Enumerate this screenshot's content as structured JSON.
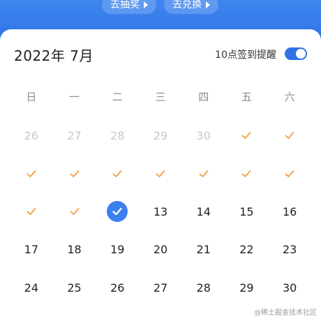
{
  "header": {
    "lottery_label": "去抽奖",
    "exchange_label": "去兑换"
  },
  "calendar": {
    "title": "2022年 7月",
    "reminder_label": "10点签到提醒",
    "reminder_on": true,
    "weekdays": [
      "日",
      "一",
      "二",
      "三",
      "四",
      "五",
      "六"
    ],
    "rows": [
      [
        {
          "label": "26",
          "state": "other-month"
        },
        {
          "label": "27",
          "state": "other-month"
        },
        {
          "label": "28",
          "state": "other-month"
        },
        {
          "label": "29",
          "state": "other-month"
        },
        {
          "label": "30",
          "state": "other-month"
        },
        {
          "label": "",
          "state": "signed"
        },
        {
          "label": "",
          "state": "signed"
        }
      ],
      [
        {
          "label": "",
          "state": "signed"
        },
        {
          "label": "",
          "state": "signed"
        },
        {
          "label": "",
          "state": "signed"
        },
        {
          "label": "",
          "state": "signed"
        },
        {
          "label": "",
          "state": "signed"
        },
        {
          "label": "",
          "state": "signed"
        },
        {
          "label": "",
          "state": "signed"
        }
      ],
      [
        {
          "label": "",
          "state": "signed"
        },
        {
          "label": "",
          "state": "signed"
        },
        {
          "label": "",
          "state": "today-signed"
        },
        {
          "label": "13",
          "state": "normal"
        },
        {
          "label": "14",
          "state": "normal"
        },
        {
          "label": "15",
          "state": "normal"
        },
        {
          "label": "16",
          "state": "normal"
        }
      ],
      [
        {
          "label": "17",
          "state": "normal"
        },
        {
          "label": "18",
          "state": "normal"
        },
        {
          "label": "19",
          "state": "normal"
        },
        {
          "label": "20",
          "state": "normal"
        },
        {
          "label": "21",
          "state": "normal"
        },
        {
          "label": "22",
          "state": "normal"
        },
        {
          "label": "23",
          "state": "normal"
        }
      ],
      [
        {
          "label": "24",
          "state": "normal"
        },
        {
          "label": "25",
          "state": "normal"
        },
        {
          "label": "26",
          "state": "normal"
        },
        {
          "label": "27",
          "state": "normal"
        },
        {
          "label": "28",
          "state": "normal"
        },
        {
          "label": "29",
          "state": "normal"
        },
        {
          "label": "30",
          "state": "normal"
        }
      ]
    ]
  },
  "colors": {
    "accent": "#2f73e6",
    "check": "#f0a64a",
    "today": "#3e7ff0"
  },
  "icons": {
    "signed": "check-icon",
    "today": "check-circle-icon",
    "toggle": "toggle-switch"
  },
  "watermark": "@稀土掘金技术社区"
}
